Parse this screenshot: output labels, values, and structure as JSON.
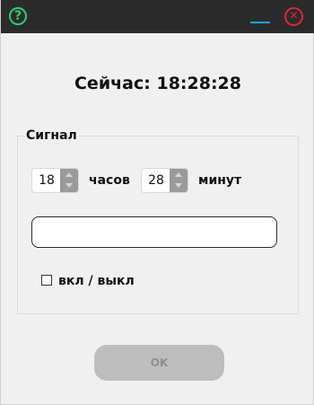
{
  "titlebar": {
    "help_glyph": "?",
    "close_glyph": "×",
    "help_icon": "question-circle-icon",
    "minimize_icon": "minimize-dash-icon",
    "close_icon": "close-circle-icon",
    "colors": {
      "background": "#2b2b2b",
      "help": "#2ecc71",
      "minimize": "#1da1f2",
      "close": "#e0253f"
    }
  },
  "clock": {
    "label": "Сейчас:",
    "time": "18:28:28"
  },
  "alarm_group": {
    "title": "Сигнал",
    "hours": {
      "value": "18",
      "unit_label": "часов"
    },
    "minutes": {
      "value": "28",
      "unit_label": "минут"
    },
    "message": {
      "value": ""
    },
    "toggle": {
      "label": "вкл / выкл",
      "checked": false
    }
  },
  "ok_button": {
    "label": "OK",
    "enabled": false
  }
}
